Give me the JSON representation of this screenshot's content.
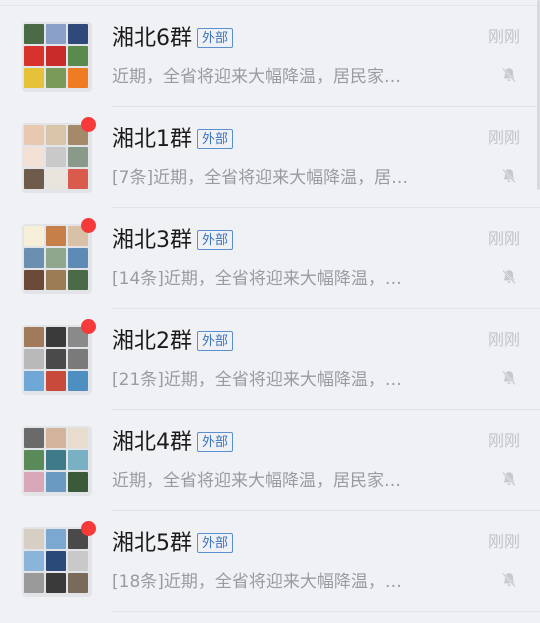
{
  "chats": [
    {
      "name": "湘北6群",
      "tag": "外部",
      "preview": "近期，全省将迎来大幅降温，居民家…",
      "time": "刚刚",
      "unread_dot": false,
      "muted": true,
      "avatar_colors": [
        "#4a6b45",
        "#8aa0c8",
        "#2f4a7a",
        "#d7332c",
        "#c92a2a",
        "#5b8a4d",
        "#e6c23a",
        "#7a9a5a",
        "#ef7b23"
      ]
    },
    {
      "name": "湘北1群",
      "tag": "外部",
      "preview": "[7条]近期，全省将迎来大幅降温，居…",
      "time": "刚刚",
      "unread_dot": true,
      "muted": true,
      "avatar_colors": [
        "#e8c9b0",
        "#d9c6a8",
        "#a58a6a",
        "#f3e1d6",
        "#c9c9c9",
        "#8a9a8a",
        "#6e5b4c",
        "#e9e4dc",
        "#d85b4b"
      ]
    },
    {
      "name": "湘北3群",
      "tag": "外部",
      "preview": "[14条]近期，全省将迎来大幅降温，…",
      "time": "刚刚",
      "unread_dot": true,
      "muted": true,
      "avatar_colors": [
        "#f6efd9",
        "#c77f4a",
        "#d8c1a6",
        "#6a8fb0",
        "#8fa78c",
        "#5e8bb6",
        "#6b4a3a",
        "#9c7c55",
        "#4a6a48"
      ]
    },
    {
      "name": "湘北2群",
      "tag": "外部",
      "preview": "[21条]近期，全省将迎来大幅降温，…",
      "time": "刚刚",
      "unread_dot": true,
      "muted": true,
      "avatar_colors": [
        "#a07a5a",
        "#3a3a3a",
        "#8a8a8a",
        "#b9b9b9",
        "#4a4a4a",
        "#7a7a7a",
        "#6fa7d6",
        "#c84a3a",
        "#4d8fc0"
      ]
    },
    {
      "name": "湘北4群",
      "tag": "外部",
      "preview": "近期，全省将迎来大幅降温，居民家…",
      "time": "刚刚",
      "unread_dot": false,
      "muted": true,
      "avatar_colors": [
        "#6a6a6a",
        "#d2b49a",
        "#e8dccf",
        "#5a8a5a",
        "#3e7a8a",
        "#7ab0c4",
        "#d8a8b8",
        "#6a9ac0",
        "#3a5a3a"
      ]
    },
    {
      "name": "湘北5群",
      "tag": "外部",
      "preview": "[18条]近期，全省将迎来大幅降温，…",
      "time": "刚刚",
      "unread_dot": true,
      "muted": true,
      "avatar_colors": [
        "#d8cfc4",
        "#7aa8d0",
        "#4a4a4a",
        "#8ab4da",
        "#2a4a7a",
        "#c9c9c9",
        "#9a9a9a",
        "#3a3a3a",
        "#7a6a5a"
      ]
    }
  ]
}
